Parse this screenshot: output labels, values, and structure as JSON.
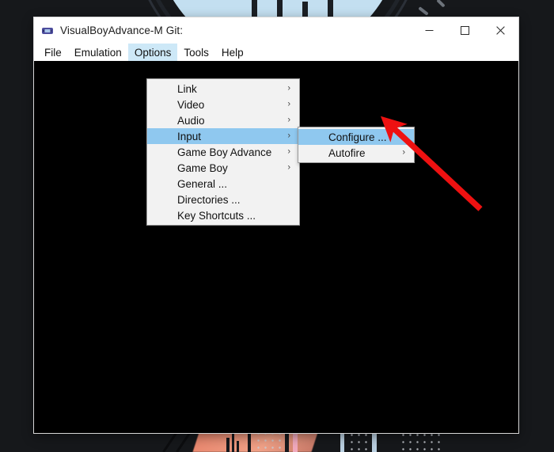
{
  "window": {
    "title": "VisualBoyAdvance-M Git:",
    "icon": "gameboy-icon",
    "controls": {
      "minimize": "—",
      "maximize": "☐",
      "close": "✕"
    }
  },
  "menubar": {
    "items": [
      {
        "label": "File",
        "open": false
      },
      {
        "label": "Emulation",
        "open": false
      },
      {
        "label": "Options",
        "open": true
      },
      {
        "label": "Tools",
        "open": false
      },
      {
        "label": "Help",
        "open": false
      }
    ]
  },
  "options_menu": {
    "items": [
      {
        "label": "Link",
        "submenu": true,
        "selected": false
      },
      {
        "label": "Video",
        "submenu": true,
        "selected": false
      },
      {
        "label": "Audio",
        "submenu": true,
        "selected": false
      },
      {
        "label": "Input",
        "submenu": true,
        "selected": true
      },
      {
        "label": "Game Boy Advance",
        "submenu": true,
        "selected": false
      },
      {
        "label": "Game Boy",
        "submenu": true,
        "selected": false
      },
      {
        "label": "General ...",
        "submenu": false,
        "selected": false
      },
      {
        "label": "Directories ...",
        "submenu": false,
        "selected": false
      },
      {
        "label": "Key Shortcuts ...",
        "submenu": false,
        "selected": false
      }
    ]
  },
  "input_submenu": {
    "items": [
      {
        "label": "Configure ...",
        "submenu": false,
        "selected": true
      },
      {
        "label": "Autofire",
        "submenu": true,
        "selected": false
      }
    ]
  },
  "annotation": {
    "arrow_color": "#ee1111",
    "arrow_from": "607,264",
    "arrow_to": "485,150"
  },
  "colors": {
    "highlight": "#8fc8ef",
    "menubar_open": "#cde8f7",
    "menu_bg": "#f2f2f2",
    "viewport": "#000000",
    "desktop": "#16181b",
    "wallpaper_accent": "#c3dff0"
  },
  "submenu_arrow_glyph": "›"
}
